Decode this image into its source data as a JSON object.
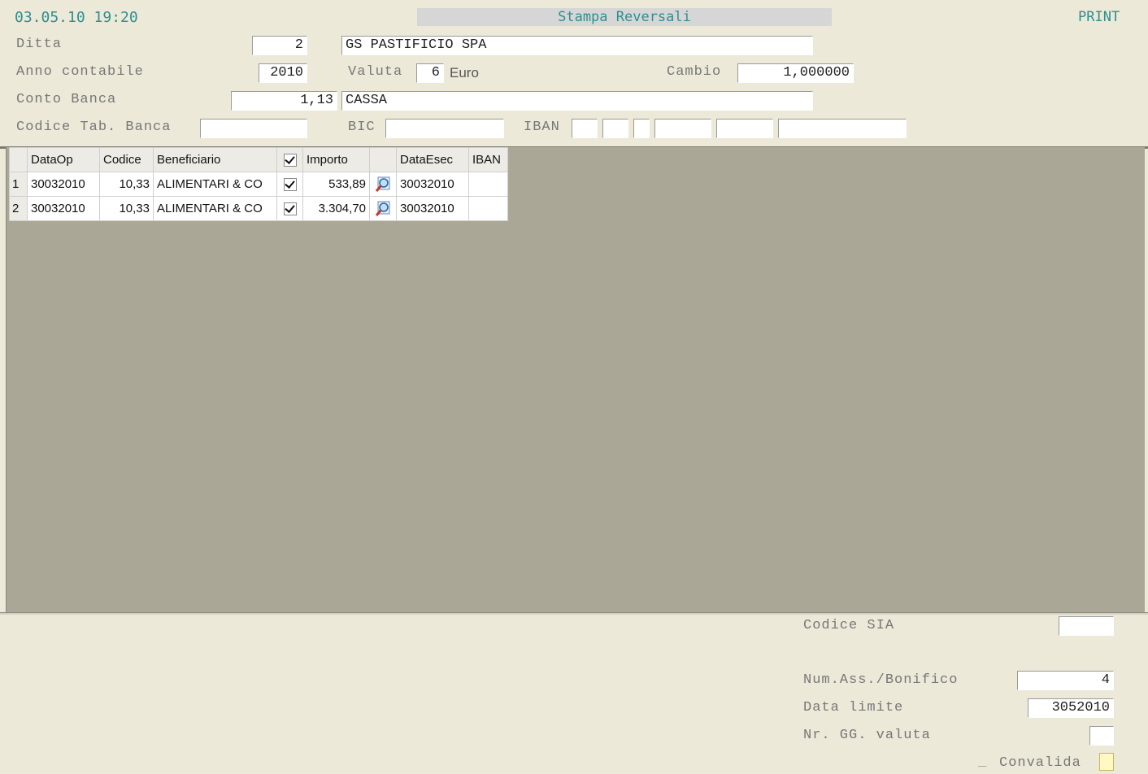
{
  "header": {
    "datetime": "03.05.10 19:20",
    "title": "Stampa Reversali",
    "mode": "PRINT",
    "ditta_label": "Ditta",
    "ditta_value": "2",
    "ditta_name": "GS PASTIFICIO SPA",
    "anno_label": "Anno contabile",
    "anno_value": "2010",
    "valuta_label": "Valuta",
    "valuta_code": "6",
    "valuta_name": "Euro",
    "cambio_label": "Cambio",
    "cambio_value": "1,000000",
    "conto_label": "Conto Banca",
    "conto_value": "1,13",
    "conto_name": "CASSA",
    "codice_tab_label": "Codice Tab. Banca",
    "codice_tab_value": "",
    "bic_label": "BIC",
    "bic_value": "",
    "iban_label": "IBAN",
    "iban_parts": [
      "",
      "",
      "",
      "",
      "",
      ""
    ]
  },
  "grid": {
    "columns": [
      "DataOp",
      "Codice",
      "Beneficiario",
      "",
      "Importo",
      "",
      "DataEsec",
      "IBAN"
    ],
    "rows": [
      {
        "n": "1",
        "dataop": "30032010",
        "codice": "10,33",
        "beneficiario": "ALIMENTARI & CO",
        "checked": true,
        "importo": "533,89",
        "dataesec": "30032010",
        "iban": ""
      },
      {
        "n": "2",
        "dataop": "30032010",
        "codice": "10,33",
        "beneficiario": "ALIMENTARI & CO",
        "checked": true,
        "importo": "3.304,70",
        "dataesec": "30032010",
        "iban": ""
      }
    ]
  },
  "footer": {
    "codice_sia_label": "Codice SIA",
    "codice_sia_value": "",
    "num_ass_label": "Num.Ass./Bonifico",
    "num_ass_value": "4",
    "data_limite_label": "Data limite",
    "data_limite_value": "3052010",
    "nr_gg_label": "Nr. GG. valuta",
    "nr_gg_value": "",
    "convalida_label": "Convalida",
    "convalida_marker": "_"
  },
  "colors": {
    "teal": "#2f8f8f",
    "grid_bg": "#aba797",
    "form_bg": "#ece9d8"
  }
}
